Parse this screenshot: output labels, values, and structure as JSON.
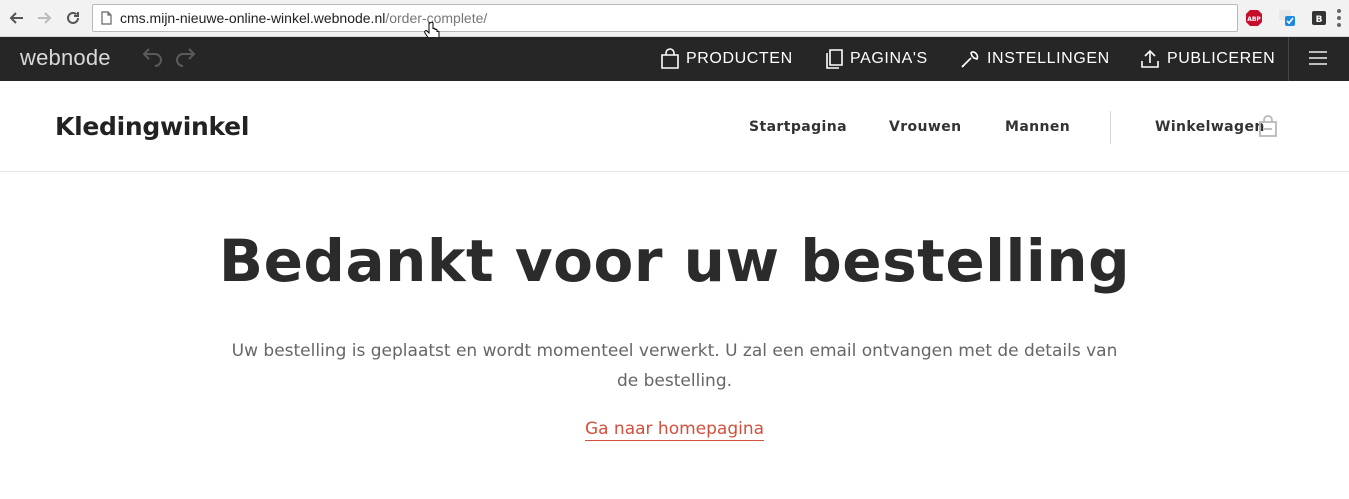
{
  "browser": {
    "url_host": "cms.mijn-nieuwe-online-winkel.webnode.nl",
    "url_path": "/order-complete/",
    "extensions": [
      "adblock-icon",
      "checker-icon",
      "bb-icon"
    ]
  },
  "toolbar": {
    "logo": "webnode",
    "items": [
      {
        "label": "PRODUCTEN",
        "icon": "shopping-bag-icon"
      },
      {
        "label": "PAGINA'S",
        "icon": "pages-icon"
      },
      {
        "label": "INSTELLINGEN",
        "icon": "wrench-icon"
      },
      {
        "label": "PUBLICEREN",
        "icon": "upload-icon"
      }
    ]
  },
  "site": {
    "logo": "Kledingwinkel",
    "nav": [
      "Startpagina",
      "Vrouwen",
      "Mannen"
    ],
    "cart_label": "Winkelwagen"
  },
  "main": {
    "headline": "Bedankt voor uw bestelling",
    "message": "Uw bestelling is geplaatst en wordt momenteel verwerkt. U zal een email ontvangen met de details van de bestelling.",
    "link": "Ga naar homepagina"
  },
  "colors": {
    "toolbar_bg": "#262626",
    "link": "#d3503a",
    "text": "#2b2b2b"
  }
}
